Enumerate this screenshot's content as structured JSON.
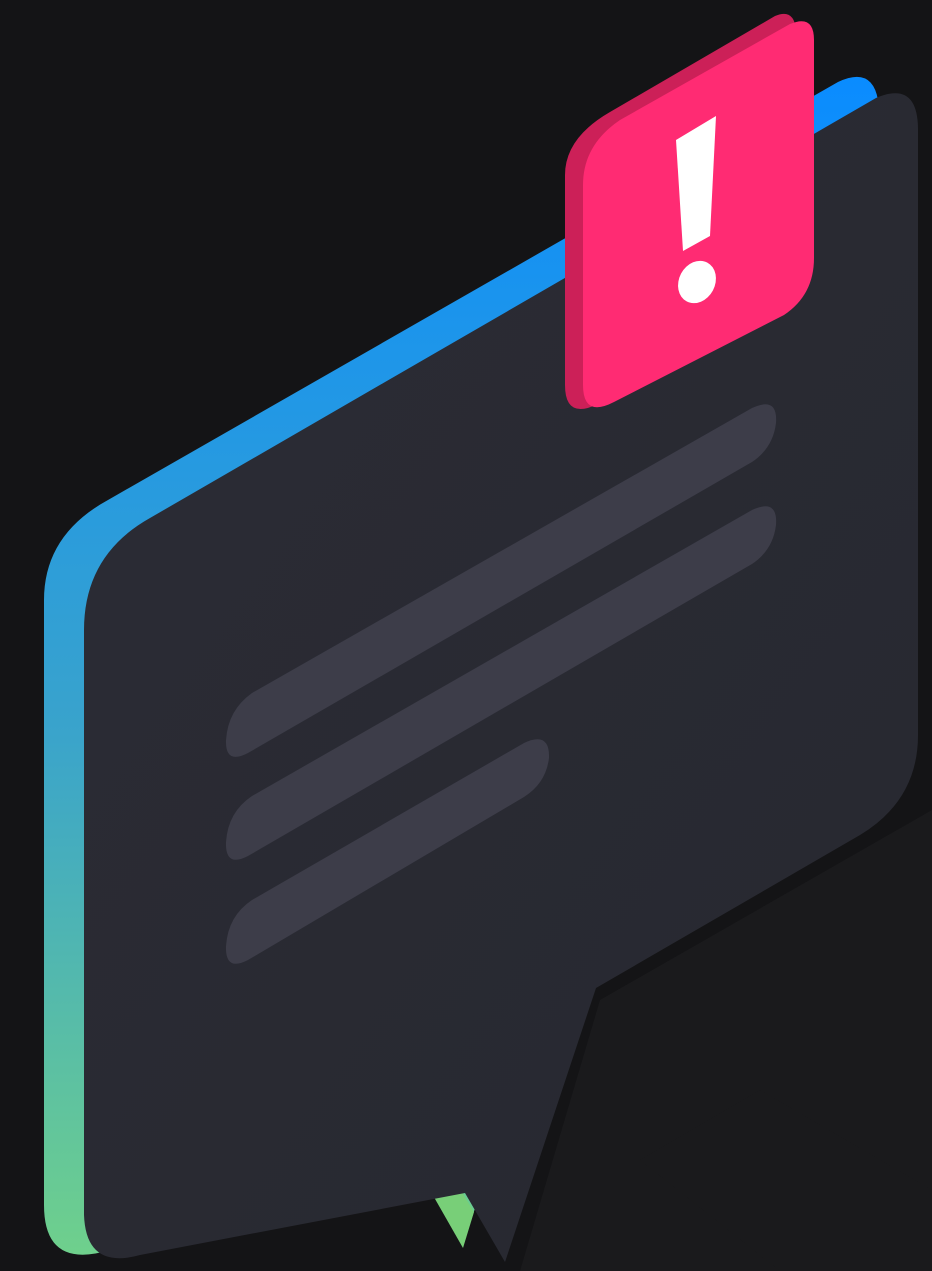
{
  "scene": {
    "subject": "isometric-chat-bubble-with-alert-badge",
    "icons": [
      "chat-bubble-icon",
      "alert-badge-icon",
      "exclamation-icon"
    ],
    "colors": {
      "background": "#141416",
      "background_panel": "#1b1b1d",
      "bubble_face": "#272830",
      "bubble_face_light": "#2b2c35",
      "text_line": "#3d3d49",
      "edge_gradient_top": "#0a8cff",
      "edge_gradient_mid": "#39a3cc",
      "edge_gradient_bottom": "#6fd08c",
      "tail_edge": "#78cf78",
      "badge_face": "#ff2b73",
      "badge_edge": "#cc2058",
      "badge_glyph": "#ffffff"
    },
    "text_line_count": 3,
    "badge_glyph": "!"
  }
}
